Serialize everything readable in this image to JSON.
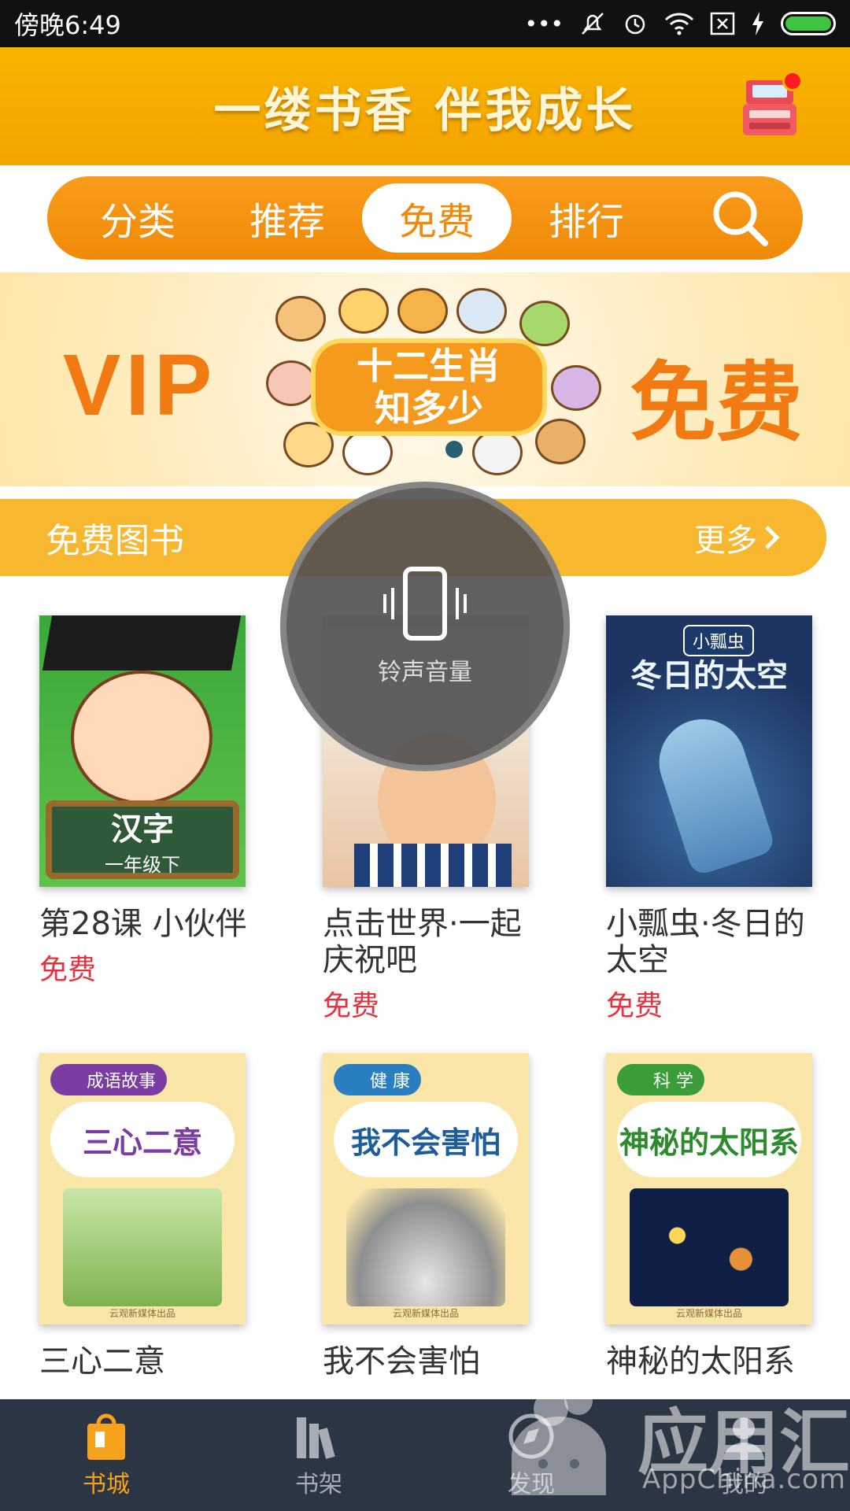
{
  "status": {
    "time": "傍晚6:49"
  },
  "header": {
    "title": "一缕书香 伴我成长"
  },
  "nav": {
    "tabs": [
      "分类",
      "推荐",
      "免费",
      "排行"
    ],
    "active": "免费"
  },
  "banner": {
    "left_text": "VIP",
    "plate_line1": "十二生肖",
    "plate_line2": "知多少",
    "right_text": "免费"
  },
  "section": {
    "title": "免费图书",
    "more": "更多"
  },
  "books": [
    {
      "title": "第28课 小伙伴",
      "price": "免费",
      "cover_big": "汉字",
      "cover_small": "一年级下"
    },
    {
      "title": "点击世界·一起庆祝吧",
      "price": "免费"
    },
    {
      "title": "小瓢虫·冬日的太空",
      "price": "免费",
      "cover_tag": "小瓢虫",
      "cover_title": "冬日的太空"
    },
    {
      "title": "三心二意",
      "cover_tag": "成语故事",
      "cover_title": "三心二意",
      "cover_footer": "云观新媒体出品"
    },
    {
      "title": "我不会害怕",
      "cover_tag": "健 康",
      "cover_title": "我不会害怕",
      "cover_footer": "云观新媒体出品"
    },
    {
      "title": "神秘的太阳系",
      "cover_tag": "科 学",
      "cover_title": "神秘的太阳系",
      "cover_footer": "云观新媒体出品"
    }
  ],
  "volume": {
    "label": "铃声音量"
  },
  "bottom_nav": {
    "items": [
      "书城",
      "书架",
      "发现",
      "我的"
    ],
    "active": "书城"
  },
  "watermark": {
    "big": "应用汇",
    "small": "AppChina.com"
  },
  "colors": {
    "header": "#f7b500",
    "nav": "#f08a08",
    "price": "#e5323e",
    "bottom_bar": "#2c3544",
    "bottom_active": "#f7a21b"
  }
}
